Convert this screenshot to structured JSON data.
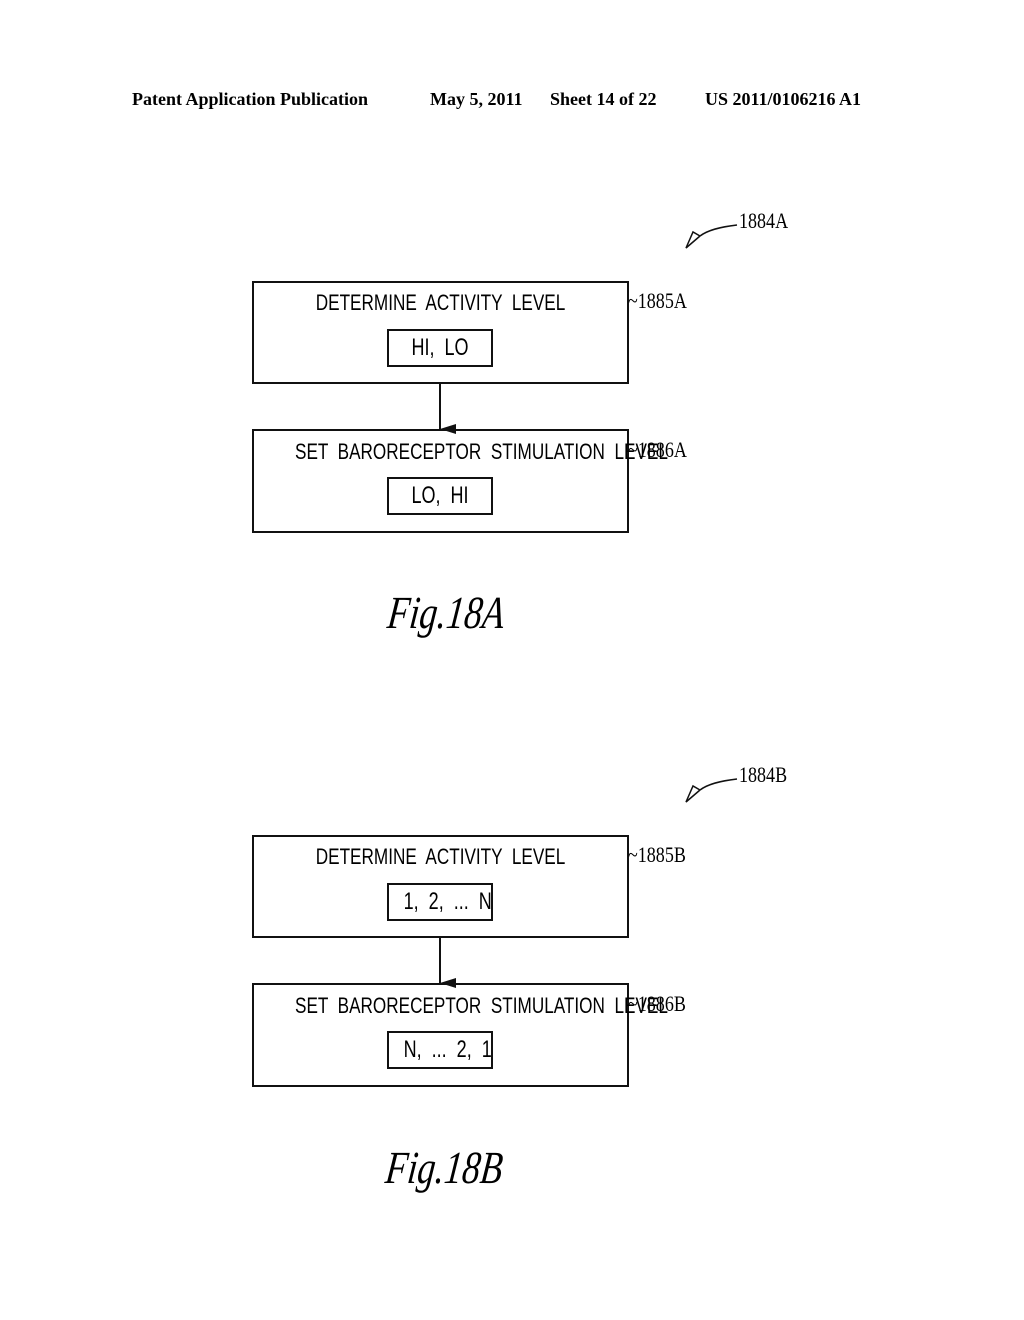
{
  "header": {
    "publication": "Patent Application Publication",
    "date": "May 5, 2011",
    "sheet": "Sheet 14 of 22",
    "number": "US 2011/0106216 A1"
  },
  "figures": [
    {
      "caption": "Fig.18A",
      "ref_label": "1884A",
      "boxes": [
        {
          "ref": "~1885A",
          "title": "DETERMINE  ACTIVITY  LEVEL",
          "value": "HI,  LO"
        },
        {
          "ref": "~1886A",
          "title": "SET  BARORECEPTOR  STIMULATION  LEVEL",
          "value": "LO,  HI"
        }
      ]
    },
    {
      "caption": "Fig.18B",
      "ref_label": "1884B",
      "boxes": [
        {
          "ref": "~1885B",
          "title": "DETERMINE  ACTIVITY  LEVEL",
          "value": "1,  2,  ...  N"
        },
        {
          "ref": "~1886B",
          "title": "SET  BARORECEPTOR  STIMULATION  LEVEL",
          "value": "N,  ...  2,  1"
        }
      ]
    }
  ]
}
